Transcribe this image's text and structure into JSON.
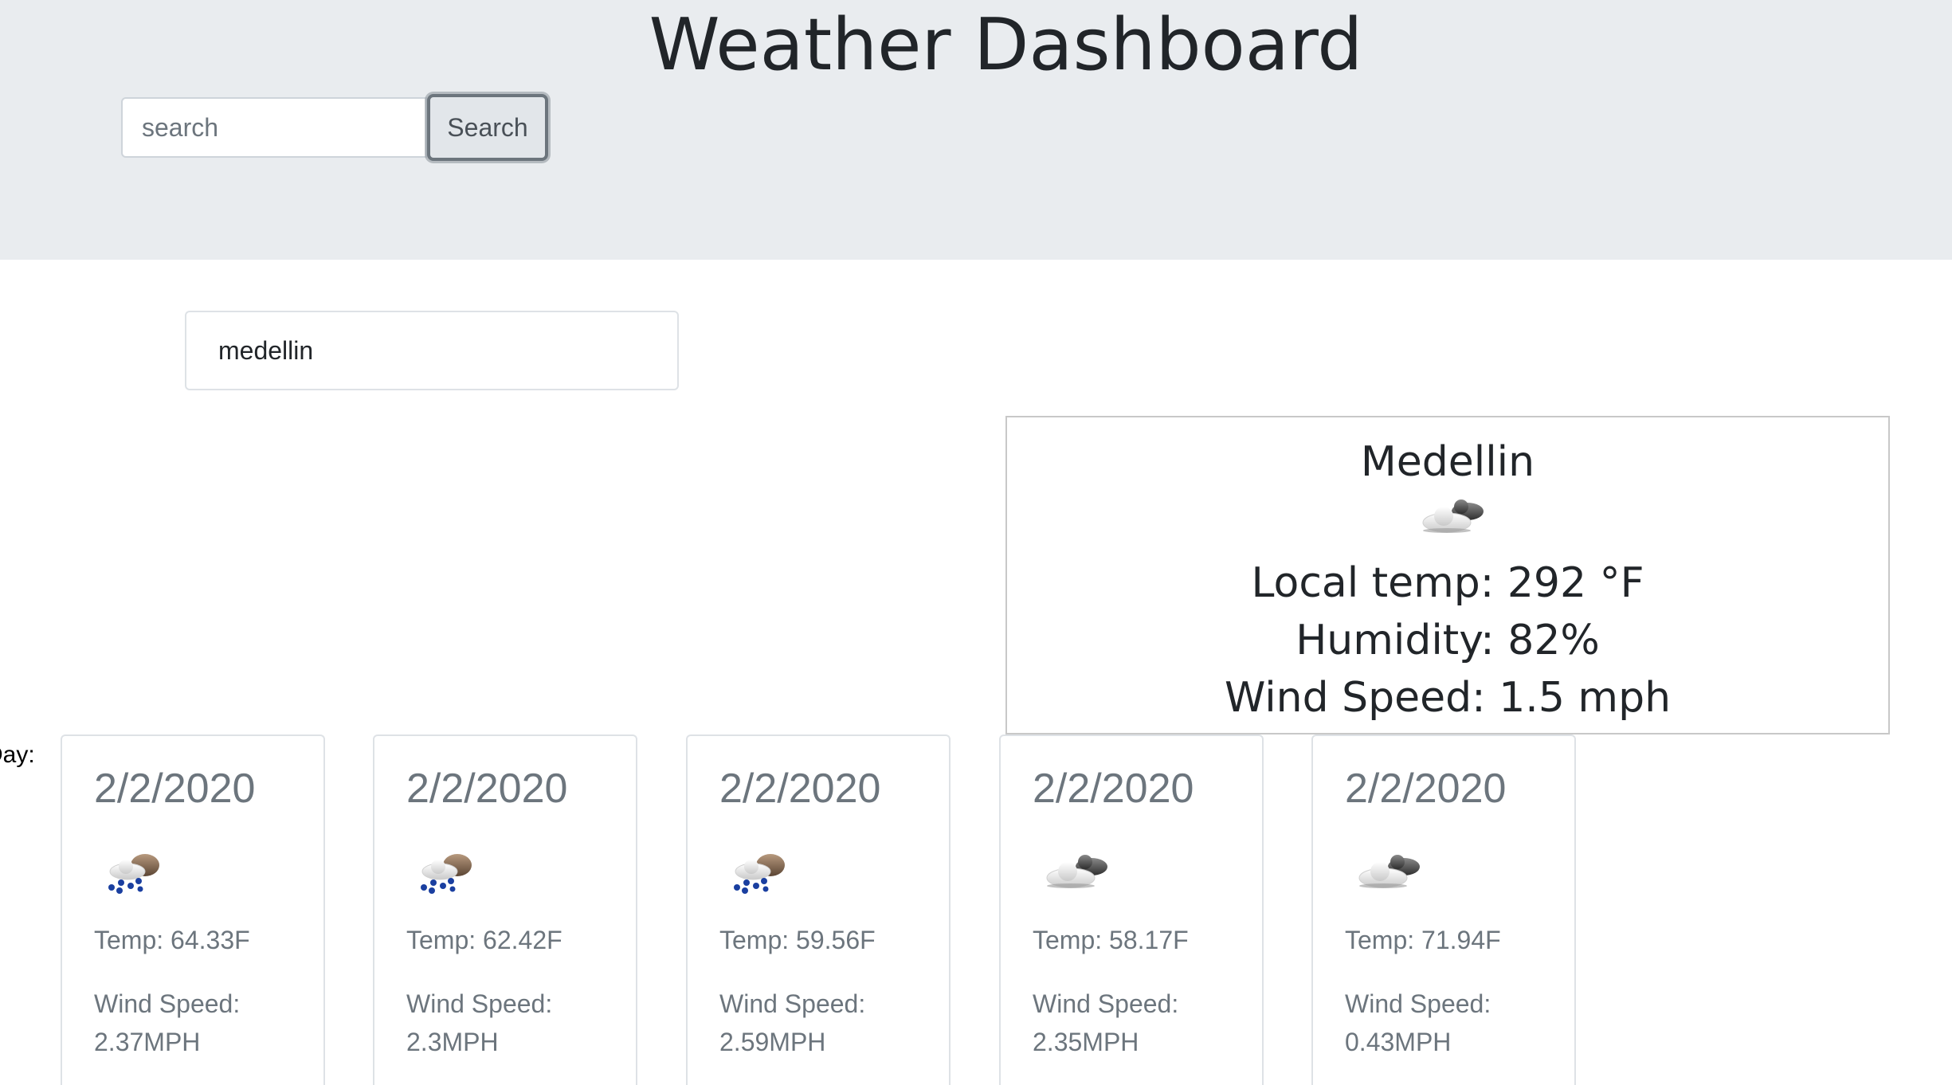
{
  "header": {
    "title": "Weather Dashboard",
    "search_placeholder": "search",
    "search_button": "Search"
  },
  "history": [
    {
      "city": "medellin"
    }
  ],
  "current": {
    "city": "Medellin",
    "icon": "cloudy-icon",
    "local_temp": "Local temp: 292 °F",
    "humidity": "Humidity: 82%",
    "wind_speed": "Wind Speed: 1.5 mph"
  },
  "forecast_label": "Day:",
  "forecast": [
    {
      "date": "2/2/2020",
      "icon": "rain-icon",
      "temp": "Temp: 64.33F",
      "wind_label": "Wind Speed:",
      "wind": "2.37MPH"
    },
    {
      "date": "2/2/2020",
      "icon": "rain-icon",
      "temp": "Temp: 62.42F",
      "wind_label": "Wind Speed:",
      "wind": "2.3MPH"
    },
    {
      "date": "2/2/2020",
      "icon": "rain-icon",
      "temp": "Temp: 59.56F",
      "wind_label": "Wind Speed:",
      "wind": "2.59MPH"
    },
    {
      "date": "2/2/2020",
      "icon": "cloudy-icon",
      "temp": "Temp: 58.17F",
      "wind_label": "Wind Speed:",
      "wind": "2.35MPH"
    },
    {
      "date": "2/2/2020",
      "icon": "cloudy-icon",
      "temp": "Temp: 71.94F",
      "wind_label": "Wind Speed:",
      "wind": "0.43MPH"
    }
  ],
  "colors": {
    "header_bg": "#e9ecef",
    "muted_text": "#6c757d",
    "rain_drop": "#1a3fa0"
  }
}
